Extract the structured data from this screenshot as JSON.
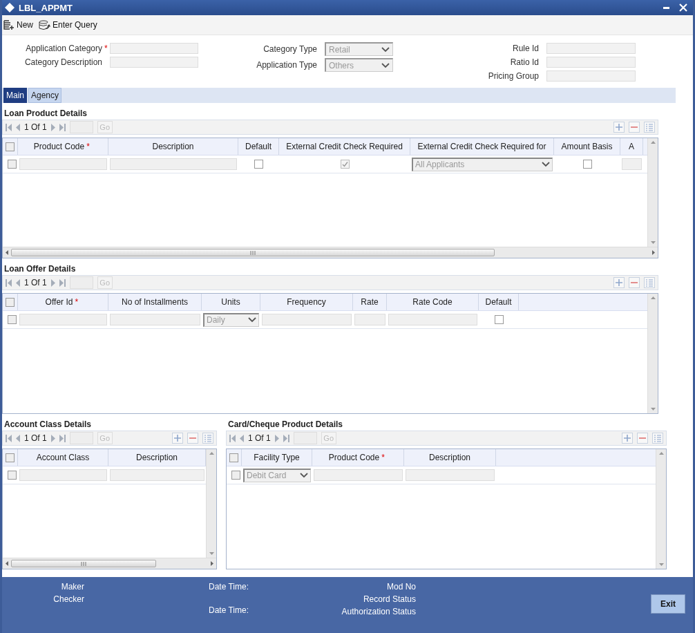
{
  "window": {
    "title": "LBL_APPMT"
  },
  "toolbar": [
    {
      "label": "New",
      "kind": "new"
    },
    {
      "label": "Enter Query",
      "kind": "query"
    }
  ],
  "header": {
    "column_1": [
      {
        "label": "Application Category",
        "required_mark": "*",
        "kind": "text"
      },
      {
        "label": "Category Description",
        "kind": "text"
      }
    ],
    "column_2": [
      {
        "label": "Category Type",
        "kind": "select",
        "value": "Retail"
      },
      {
        "label": "Application Type",
        "kind": "select",
        "value": "Others"
      }
    ],
    "column_3": [
      {
        "label": "Rule Id",
        "kind": "text"
      },
      {
        "label": "Ratio Id",
        "kind": "text"
      },
      {
        "label": "Pricing Group",
        "kind": "text"
      }
    ]
  },
  "tabs": [
    {
      "label": "Main",
      "selected": true
    },
    {
      "label": "Agency",
      "selected": false
    }
  ],
  "sections": [
    {
      "title": "Loan Product Details",
      "pager": "1 Of 1",
      "go": "Go",
      "select_all_checked": false,
      "horizontal_scroll": true,
      "columns": [
        {
          "label": "Product Code",
          "required_mark": "*"
        },
        {
          "label": "Description"
        },
        {
          "label": "Default"
        },
        {
          "label": "External Credit Check Required"
        },
        {
          "label": "External Credit Check Required for"
        },
        {
          "label": "Amount Basis"
        },
        {
          "label": "A"
        }
      ],
      "rows": [
        {
          "selected": false,
          "cells": [
            {
              "kind": "text"
            },
            {
              "kind": "text"
            },
            {
              "kind": "checkbox",
              "checked": false,
              "disabled": false
            },
            {
              "kind": "checkbox",
              "checked": true,
              "disabled": true
            },
            {
              "kind": "select",
              "value": "All Applicants"
            },
            {
              "kind": "checkbox",
              "checked": false,
              "disabled": false
            },
            {
              "kind": "text"
            }
          ]
        }
      ]
    },
    {
      "title": "Loan Offer Details",
      "pager": "1 Of 1",
      "go": "Go",
      "select_all_checked": false,
      "horizontal_scroll": false,
      "columns": [
        {
          "label": "Offer Id",
          "required_mark": "*"
        },
        {
          "label": "No of Installments"
        },
        {
          "label": "Units"
        },
        {
          "label": "Frequency"
        },
        {
          "label": "Rate"
        },
        {
          "label": "Rate Code"
        },
        {
          "label": "Default"
        }
      ],
      "rows": [
        {
          "selected": false,
          "cells": [
            {
              "kind": "text"
            },
            {
              "kind": "text"
            },
            {
              "kind": "select",
              "value": "Daily"
            },
            {
              "kind": "text"
            },
            {
              "kind": "text"
            },
            {
              "kind": "text"
            },
            {
              "kind": "checkbox",
              "checked": false,
              "disabled": false
            }
          ]
        }
      ]
    },
    {
      "title": "Account Class Details",
      "pager": "1 Of 1",
      "go": "Go",
      "select_all_checked": false,
      "horizontal_scroll": true,
      "columns": [
        {
          "label": "Account Class"
        },
        {
          "label": "Description"
        }
      ],
      "rows": [
        {
          "selected": false,
          "cells": [
            {
              "kind": "text"
            },
            {
              "kind": "text"
            }
          ]
        }
      ]
    },
    {
      "title": "Card/Cheque Product Details",
      "pager": "1 Of 1",
      "go": "Go",
      "select_all_checked": false,
      "horizontal_scroll": false,
      "columns": [
        {
          "label": "Facility Type"
        },
        {
          "label": "Product Code",
          "required_mark": "*"
        },
        {
          "label": "Description"
        }
      ],
      "rows": [
        {
          "selected": false,
          "cells": [
            {
              "kind": "select",
              "value": "Debit Card"
            },
            {
              "kind": "text"
            },
            {
              "kind": "text"
            }
          ]
        }
      ]
    }
  ],
  "footer": {
    "audit_labels": [
      "Maker",
      "Checker"
    ],
    "date_labels": [
      "Date Time:",
      "Date Time:"
    ],
    "status_labels": [
      "Mod No",
      "Record Status",
      "Authorization Status"
    ],
    "button": "Exit"
  }
}
